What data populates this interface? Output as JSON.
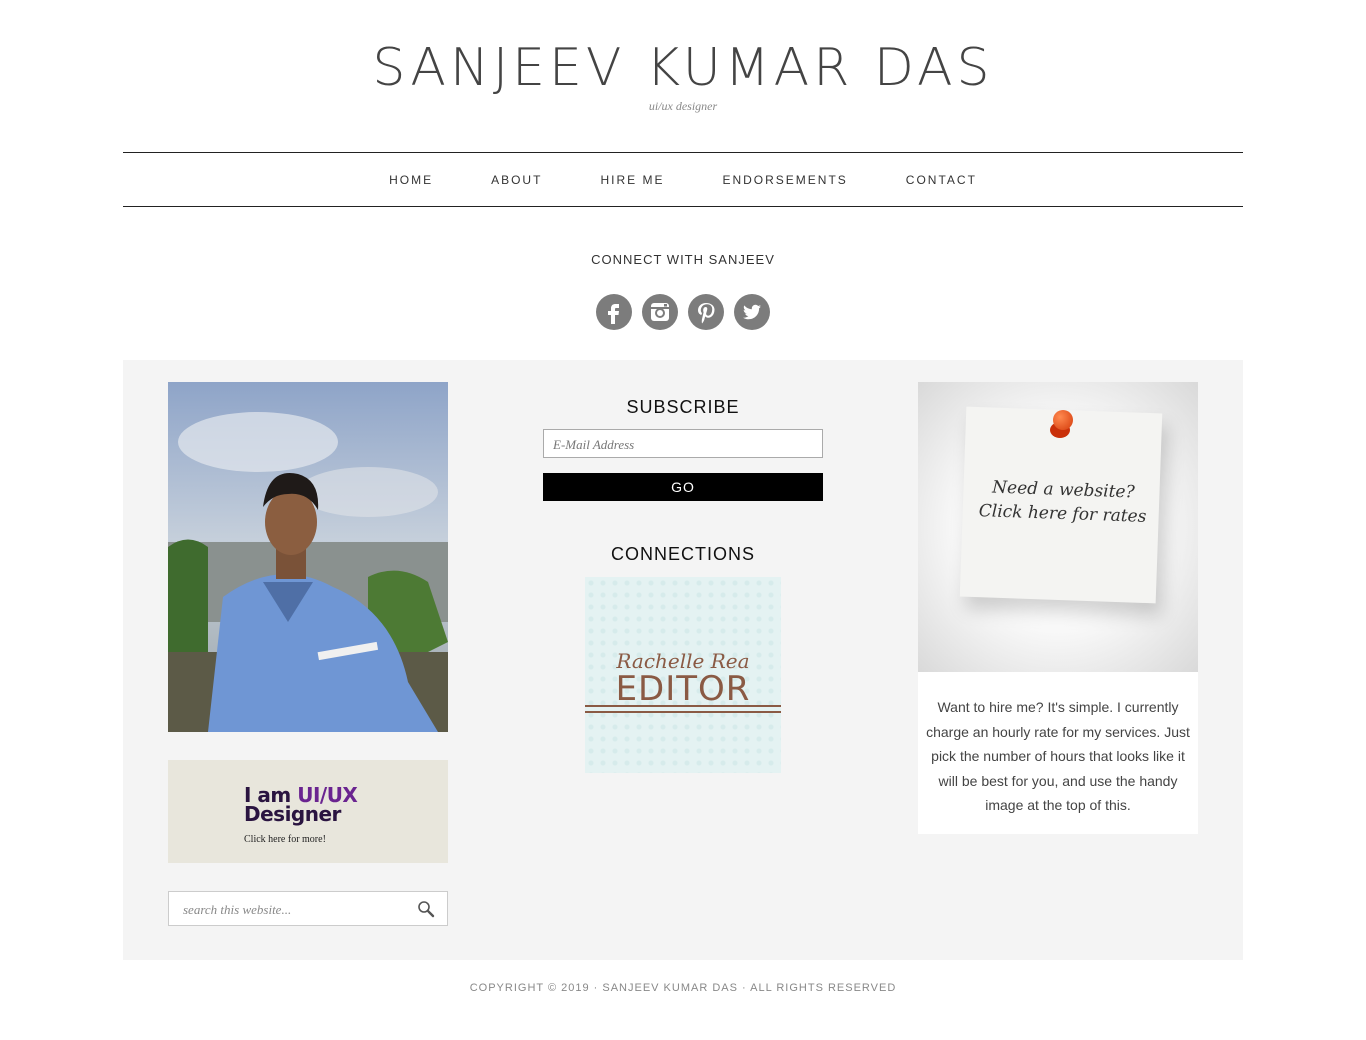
{
  "header": {
    "title": "SANJEEV KUMAR DAS",
    "description": "ui/ux designer"
  },
  "nav": {
    "items": [
      {
        "label": "HOME"
      },
      {
        "label": "ABOUT"
      },
      {
        "label": "HIRE ME"
      },
      {
        "label": "ENDORSEMENTS"
      },
      {
        "label": "CONTACT"
      }
    ]
  },
  "connect": {
    "title": "CONNECT WITH SANJEEV",
    "icons": [
      "facebook-icon",
      "instagram-icon",
      "pinterest-icon",
      "twitter-icon"
    ],
    "icon_color": "#7c7c7c"
  },
  "sidebar_left": {
    "banner_line1_a": "I am ",
    "banner_line1_b": "UI/UX",
    "banner_line2": "Designer",
    "banner_small": "Click here for more!",
    "search_placeholder": "search this website..."
  },
  "subscribe": {
    "title": "SUBSCRIBE",
    "email_placeholder": "E-Mail Address",
    "button_label": "GO"
  },
  "connections": {
    "title": "CONNECTIONS",
    "badge_script": "Rachelle Rea",
    "badge_word": "EDITOR"
  },
  "hire": {
    "note_text": "Need a website? Click here for rates",
    "body": "Want to hire me? It's simple. I currently charge an hourly rate for my services. Just pick the number of hours that looks like it will be best for you, and use the handy image at the top of this."
  },
  "footer": {
    "text": "COPYRIGHT © 2019 · SANJEEV KUMAR DAS · ALL RIGHTS RESERVED"
  }
}
